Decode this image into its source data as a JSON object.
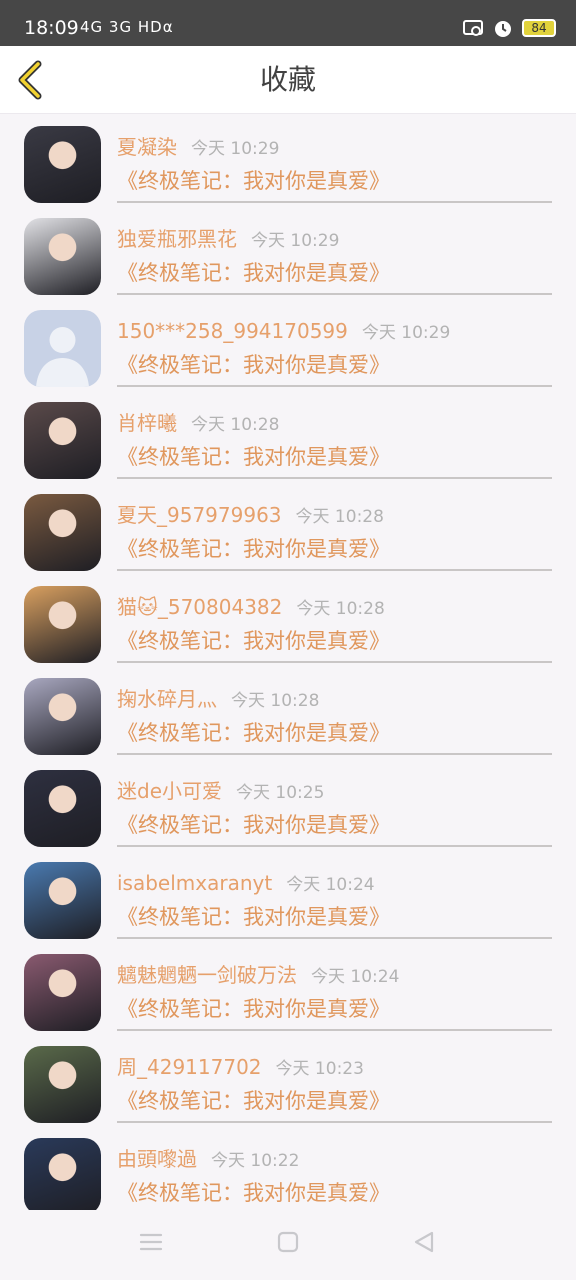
{
  "status": {
    "time": "18:09",
    "signal": "4G 3G HDα",
    "battery": "84"
  },
  "header": {
    "title": "收藏"
  },
  "items": [
    {
      "name": "夏凝染",
      "time": "今天 10:29",
      "book": "《终极笔记：我对你是真爱》"
    },
    {
      "name": "独爱瓶邪黑花",
      "time": "今天 10:29",
      "book": "《终极笔记：我对你是真爱》"
    },
    {
      "name": "150***258_994170599",
      "time": "今天 10:29",
      "book": "《终极笔记：我对你是真爱》"
    },
    {
      "name": "肖梓曦",
      "time": "今天 10:28",
      "book": "《终极笔记：我对你是真爱》"
    },
    {
      "name": "夏天_957979963",
      "time": "今天 10:28",
      "book": "《终极笔记：我对你是真爱》"
    },
    {
      "name": "猫🐱_570804382",
      "time": "今天 10:28",
      "book": "《终极笔记：我对你是真爱》"
    },
    {
      "name": "掬水碎月灬",
      "time": "今天 10:28",
      "book": "《终极笔记：我对你是真爱》"
    },
    {
      "name": "迷de小可爱",
      "time": "今天 10:25",
      "book": "《终极笔记：我对你是真爱》"
    },
    {
      "name": "isabelmxaranyt",
      "time": "今天 10:24",
      "book": "《终极笔记：我对你是真爱》"
    },
    {
      "name": "魑魅魍魉一剑破万法",
      "time": "今天 10:24",
      "book": "《终极笔记：我对你是真爱》"
    },
    {
      "name": "周_429117702",
      "time": "今天 10:23",
      "book": "《终极笔记：我对你是真爱》"
    },
    {
      "name": "由頭嚟過",
      "time": "今天 10:22",
      "book": "《终极笔记：我对你是真爱》"
    }
  ],
  "avatar_colors": [
    "#3a3a44",
    "#e2e2e6",
    "#c8d2e6",
    "#5a4a4a",
    "#7a5a40",
    "#d9a060",
    "#a9a8c0",
    "#2e3040",
    "#4a7ab0",
    "#8a5a70",
    "#5a6a4a",
    "#2a3a5a"
  ],
  "icons": {
    "back": "chevron-left-icon",
    "menu": "menu-icon",
    "home": "home-icon",
    "back_nav": "back-triangle-icon"
  }
}
